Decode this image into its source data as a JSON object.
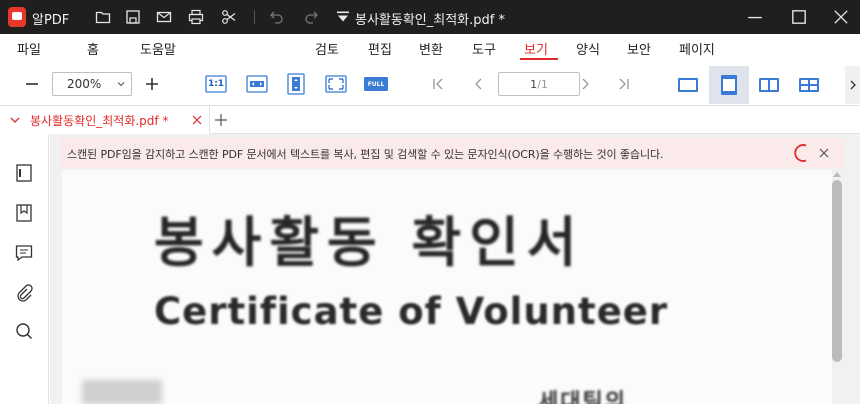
{
  "titlebar": {
    "app_name": "알PDF",
    "document_title": "봉사활동확인_최적화.pdf *",
    "colors": {
      "background": "#1f1f1f",
      "logo": "#e8382b"
    },
    "icons": [
      "folder-icon",
      "save-icon",
      "mail-icon",
      "print-icon",
      "scissors-icon",
      "undo-icon",
      "redo-icon",
      "dropdown-icon"
    ],
    "window_buttons": [
      "minimize-icon",
      "maximize-icon",
      "close-icon"
    ]
  },
  "menu": {
    "left": [
      "파일",
      "홈",
      "도움말"
    ],
    "center": [
      "검토",
      "편집",
      "변환",
      "도구",
      "보기",
      "양식",
      "보안",
      "페이지"
    ],
    "active": "보기",
    "accent_color": "#e02a2a"
  },
  "toolbar": {
    "zoom_value": "200%",
    "fit_actual_label": "1:1",
    "full_label": "FULL",
    "page_current": "1",
    "page_total": "/1",
    "selected_view": "single-page-continuous-view"
  },
  "tabs": {
    "active_tab_label": "봉사활동확인_최적화.pdf *"
  },
  "notice": {
    "text": "스캔된 PDF임을 감지하고 스캔한 PDF 문서에서 텍스트를 복사, 편집 및 검색할 수 있는 문자인식(OCR)을 수행하는 것이 좋습니다.",
    "background": "#fbeaea"
  },
  "document": {
    "heading": "봉사활동 확인서",
    "subheading": "Certificate of Volunteer",
    "partial_text": "세대팀의"
  }
}
